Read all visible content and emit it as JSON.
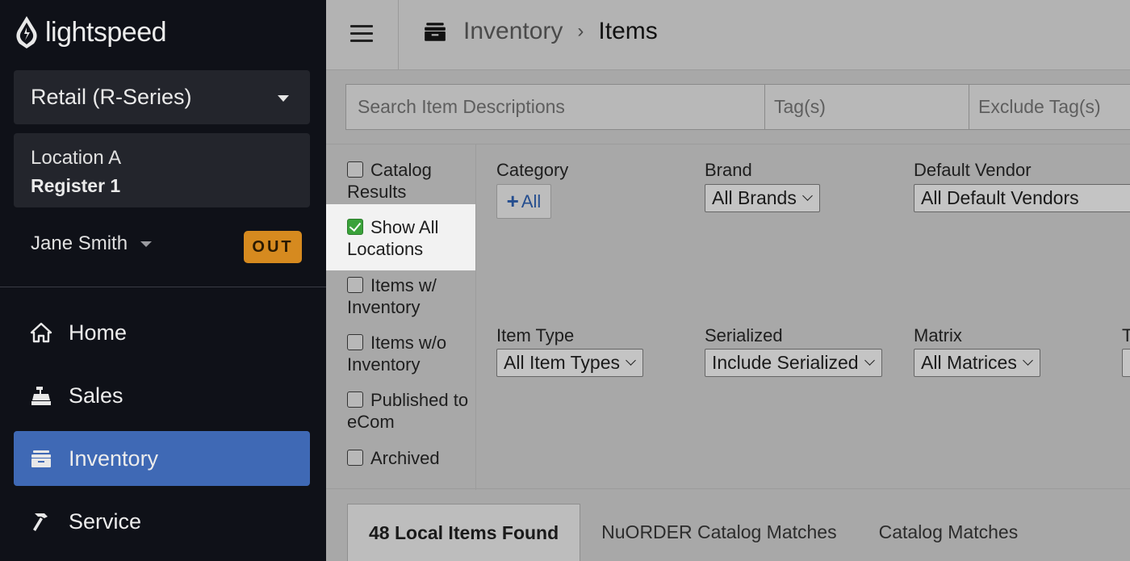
{
  "sidebar": {
    "brand": "lightspeed",
    "store_select": "Retail (R-Series)",
    "location": "Location A",
    "register": "Register 1",
    "user": "Jane Smith",
    "status_badge": "OUT",
    "nav": [
      {
        "label": "Home",
        "icon": "home-icon"
      },
      {
        "label": "Sales",
        "icon": "register-icon"
      },
      {
        "label": "Inventory",
        "icon": "inventory-icon",
        "active": true
      },
      {
        "label": "Service",
        "icon": "hammer-icon"
      }
    ],
    "active_color": "#3f69b5"
  },
  "header": {
    "breadcrumb_parent": "Inventory",
    "breadcrumb_current": "Items"
  },
  "search": {
    "description_placeholder": "Search Item Descriptions",
    "tags_placeholder": "Tag(s)",
    "exclude_tags_placeholder": "Exclude Tag(s)"
  },
  "checks": [
    {
      "label": "Catalog Results",
      "checked": false
    },
    {
      "label": "Show All Locations",
      "checked": true
    },
    {
      "label": "Items w/ Inventory",
      "checked": false
    },
    {
      "label": "Items w/o Inventory",
      "checked": false
    },
    {
      "label": "Published to eCom",
      "checked": false
    },
    {
      "label": "Archived",
      "checked": false
    }
  ],
  "filters": {
    "category_label": "Category",
    "category_button": "All",
    "brand_label": "Brand",
    "brand_value": "All Brands",
    "vendor_label": "Default Vendor",
    "vendor_value": "All Default Vendors",
    "item_type_label": "Item Type",
    "item_type_value": "All Item Types",
    "serialized_label": "Serialized",
    "serialized_value": "Include Serialized",
    "matrix_label": "Matrix",
    "matrix_value": "All Matrices",
    "cut_label": "T"
  },
  "tabs": [
    {
      "label": "48 Local Items Found",
      "active": true
    },
    {
      "label": "NuORDER Catalog Matches"
    },
    {
      "label": "Catalog Matches"
    }
  ]
}
